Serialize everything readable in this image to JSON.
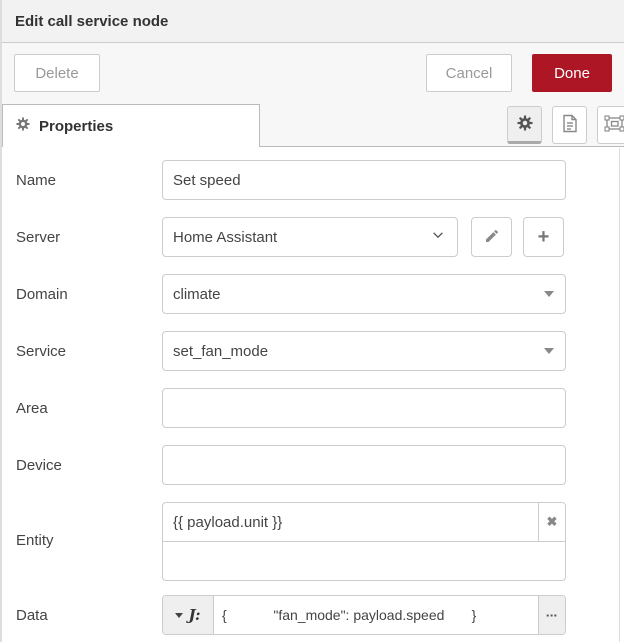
{
  "dialog": {
    "title": "Edit call service node"
  },
  "toolbar": {
    "delete_label": "Delete",
    "cancel_label": "Cancel",
    "done_label": "Done"
  },
  "tabs": {
    "properties_label": "Properties"
  },
  "form": {
    "name": {
      "label": "Name",
      "value": "Set speed"
    },
    "server": {
      "label": "Server",
      "value": "Home Assistant"
    },
    "domain": {
      "label": "Domain",
      "value": "climate"
    },
    "service": {
      "label": "Service",
      "value": "set_fan_mode"
    },
    "area": {
      "label": "Area",
      "value": ""
    },
    "device": {
      "label": "Device",
      "value": ""
    },
    "entity": {
      "label": "Entity",
      "rows": [
        {
          "value": "{{ payload.unit }}"
        },
        {
          "value": ""
        }
      ]
    },
    "data": {
      "label": "Data",
      "value": "{            \"fan_mode\": payload.speed       }"
    }
  },
  "icons": {
    "plus": "+",
    "close": "✖",
    "jsonata": "J:",
    "ellipsis": "▪▪▪"
  },
  "colors": {
    "done_red": "#AD1625",
    "header_gray": "#f2f2f2"
  }
}
